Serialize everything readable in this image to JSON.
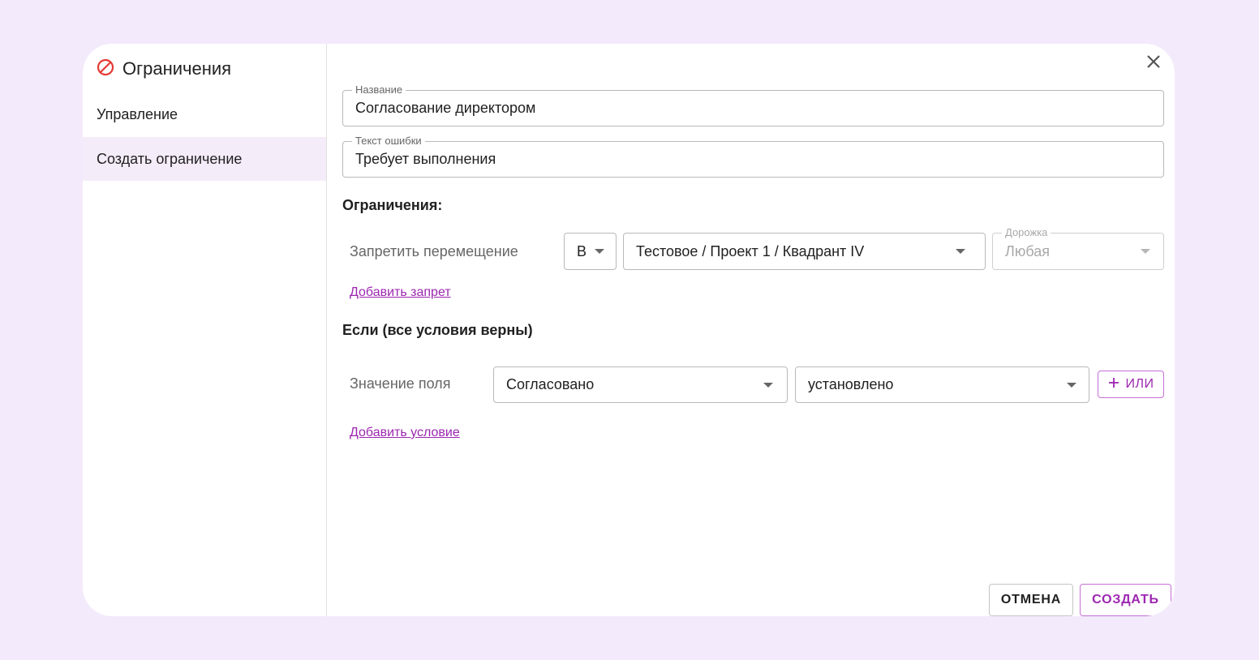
{
  "sidebar": {
    "title": "Ограничения",
    "icon": "prohibit-icon",
    "items": [
      {
        "label": "Управление",
        "active": false
      },
      {
        "label": "Создать ограничение",
        "active": true
      }
    ]
  },
  "form": {
    "name_field": {
      "legend": "Название",
      "value": "Согласование директором"
    },
    "error_field": {
      "legend": "Текст ошибки",
      "value": "Требует выполнения"
    },
    "restrictions": {
      "title": "Ограничения:",
      "row_label": "Запретить перемещение",
      "direction_value": "В",
      "target_value": "Тестовое / Проект 1 / Квадрант IV",
      "lane_legend": "Дорожка",
      "lane_value": "Любая",
      "add_link": "Добавить запрет"
    },
    "conditions": {
      "title": "Если (все условия верны)",
      "row_label": "Значение поля",
      "field_value": "Согласовано",
      "operator_value": "установлено",
      "or_button": "ИЛИ",
      "add_link": "Добавить условие"
    }
  },
  "actions": {
    "cancel": "ОТМЕНА",
    "create": "СОЗДАТЬ"
  },
  "colors": {
    "accent": "#9c27b0",
    "background": "#f3eafb",
    "prohibit": "#e53935"
  }
}
